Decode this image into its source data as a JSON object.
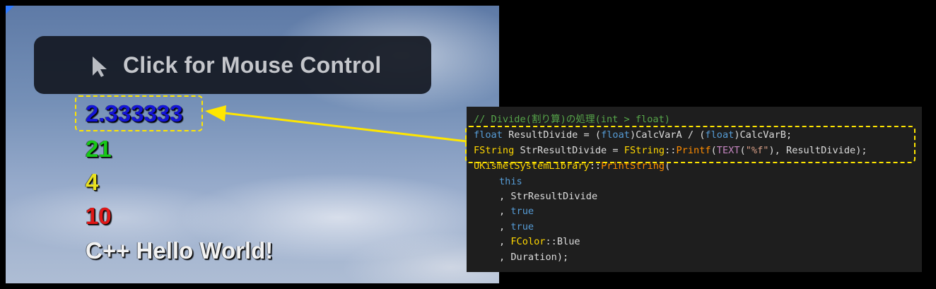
{
  "viewport": {
    "banner": {
      "label": "Click for Mouse Control",
      "icon": "cursor-arrow-icon"
    },
    "printed_lines": [
      {
        "text": "2.333333",
        "color": "#1414d8"
      },
      {
        "text": "21",
        "color": "#18c818"
      },
      {
        "text": "4",
        "color": "#e8e020"
      },
      {
        "text": "10",
        "color": "#e01818"
      },
      {
        "text": "C++ Hello World!",
        "color": "#f2f2f2"
      }
    ]
  },
  "code": {
    "comment": "// Divide(割り算)の処理(int > float)",
    "line1": {
      "kw1": "float",
      "rest1": " ResultDivide = (",
      "kw2": "float",
      "rest2": ")CalcVarA / (",
      "kw3": "float",
      "rest3": ")CalcVarB;"
    },
    "line2": {
      "type1": "FString",
      "rest1": " StrResultDivide = ",
      "type2": "FString",
      "sep": "::",
      "fn": "Printf",
      "paren": "(",
      "macro": "TEXT",
      "open": "(",
      "str": "\"%f\"",
      "rest2": "), ResultDivide);"
    },
    "line3": {
      "type": "UKismetSystemLibrary",
      "sep": "::",
      "fn": "PrintString",
      "rest": "("
    },
    "line4": {
      "kw": "this"
    },
    "line5": {
      "text": ", StrResultDivide"
    },
    "line6": {
      "prefix": ", ",
      "kw": "true"
    },
    "line7": {
      "prefix": ", ",
      "kw": "true"
    },
    "line8": {
      "prefix": ", ",
      "type": "FColor",
      "rest": "::Blue"
    },
    "line9": {
      "text": ", Duration);"
    }
  },
  "colors": {
    "highlight": "#ffe600",
    "code_bg": "#1e1e1e"
  }
}
